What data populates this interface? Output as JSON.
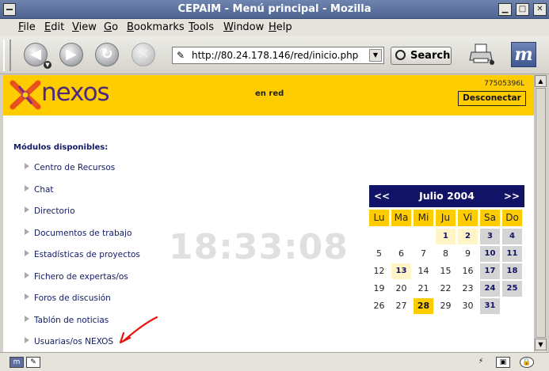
{
  "window": {
    "title": "CEPAIM - Menú principal - Mozilla"
  },
  "menubar": {
    "items": [
      "File",
      "Edit",
      "View",
      "Go",
      "Bookmarks",
      "Tools",
      "Window",
      "Help"
    ]
  },
  "toolbar": {
    "url": "http://80.24.178.146/red/inicio.php",
    "search_label": "Search"
  },
  "banner": {
    "logo_text": "nexos",
    "center_label": "en red",
    "code": "77505396L",
    "disconnect_label": "Desconectar"
  },
  "modules": {
    "title": "Módulos disponibles:",
    "items": [
      "Centro de Recursos",
      "Chat",
      "Directorio",
      "Documentos de trabajo",
      "Estadísticas de proyectos",
      "Fichero de expertas/os",
      "Foros de discusión",
      "Tablón de noticias",
      "Usuarias/os NEXOS"
    ]
  },
  "clock": {
    "time": "18:33:08"
  },
  "calendar": {
    "prev": "<<",
    "next": ">>",
    "month": "Julio 2004",
    "daynames": [
      "Lu",
      "Ma",
      "Mi",
      "Ju",
      "Vi",
      "Sa",
      "Do"
    ],
    "weeks": [
      [
        "",
        "",
        "",
        "1",
        "2",
        "3",
        "4"
      ],
      [
        "5",
        "6",
        "7",
        "8",
        "9",
        "10",
        "11"
      ],
      [
        "12",
        "13",
        "14",
        "15",
        "16",
        "17",
        "18"
      ],
      [
        "19",
        "20",
        "21",
        "22",
        "23",
        "24",
        "25"
      ],
      [
        "26",
        "27",
        "28",
        "29",
        "30",
        "31",
        ""
      ]
    ],
    "today": "28",
    "highlighted": [
      "1",
      "2",
      "13"
    ]
  },
  "colors": {
    "banner": "#ffcc00",
    "navy": "#111366",
    "link": "#111a66"
  }
}
